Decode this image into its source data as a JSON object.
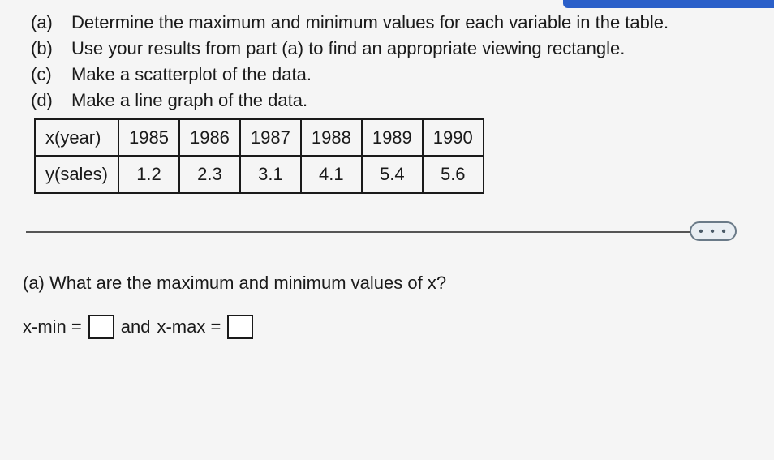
{
  "questions": {
    "a": {
      "label": "(a)",
      "text": "Determine the maximum and minimum values for each variable in the table."
    },
    "b": {
      "label": "(b)",
      "text": "Use your results from part (a) to find an appropriate viewing rectangle."
    },
    "c": {
      "label": "(c)",
      "text": "Make a scatterplot of the data."
    },
    "d": {
      "label": "(d)",
      "text": "Make a line graph of the data."
    }
  },
  "table": {
    "x_label": "x(year)",
    "y_label": "y(sales)",
    "x": [
      "1985",
      "1986",
      "1987",
      "1988",
      "1989",
      "1990"
    ],
    "y": [
      "1.2",
      "2.3",
      "3.1",
      "4.1",
      "5.4",
      "5.6"
    ]
  },
  "ellipsis": "• • •",
  "part_a": {
    "prompt": "(a) What are the maximum and minimum values of x?",
    "xmin_label": "x-min =",
    "and": "and",
    "xmax_label": "x-max ="
  },
  "chart_data": {
    "type": "table",
    "categories": [
      1985,
      1986,
      1987,
      1988,
      1989,
      1990
    ],
    "values": [
      1.2,
      2.3,
      3.1,
      4.1,
      5.4,
      5.6
    ],
    "xlabel": "x(year)",
    "ylabel": "y(sales)"
  }
}
